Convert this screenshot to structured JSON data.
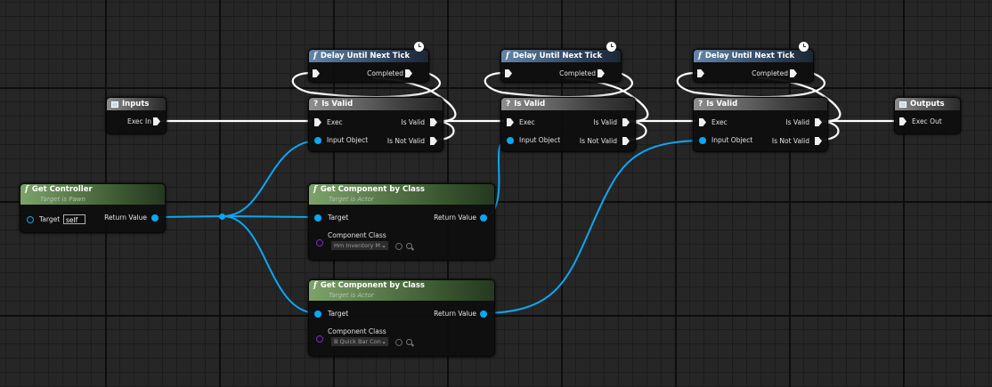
{
  "nodes": {
    "inputs": {
      "title": "Inputs",
      "exec_in": "Exec In"
    },
    "outputs": {
      "title": "Outputs",
      "exec_out": "Exec Out"
    },
    "delay": {
      "title": "Delay Until Next Tick",
      "completed": "Completed"
    },
    "is_valid": {
      "title": "Is Valid",
      "exec": "Exec",
      "input_object": "Input Object",
      "is_valid_out": "Is Valid",
      "is_not_valid_out": "Is Not Valid"
    },
    "get_controller": {
      "title": "Get Controller",
      "subtitle": "Target is Pawn",
      "target": "Target",
      "target_value": "self",
      "return_value": "Return Value"
    },
    "get_component_by_class": {
      "title": "Get Component by Class",
      "subtitle": "Target is Actor",
      "target": "Target",
      "return_value": "Return Value",
      "component_class": "Component Class"
    },
    "component_class_values": [
      "Hm Inventory M",
      "B Quick Bar Con"
    ]
  },
  "colors": {
    "wire_data": "#0aa8f2",
    "wire_exec": "#ffffff",
    "class_pin": "#7a2ad8"
  },
  "icons": {
    "function": "function-f-icon",
    "macro": "question-mark-icon",
    "tunnel": "square-icon",
    "latent": "clock-icon"
  }
}
